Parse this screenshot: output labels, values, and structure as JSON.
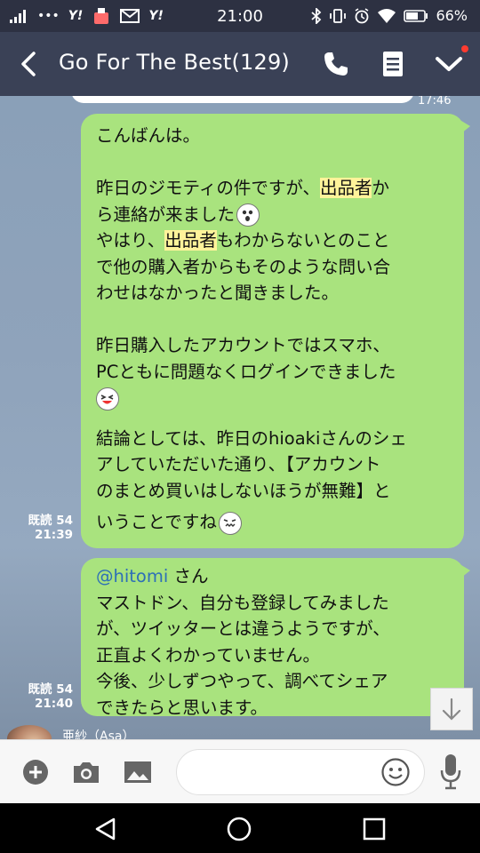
{
  "status_bar": {
    "time": "21:00",
    "battery": "66%",
    "left_glyphs": [
      "•••",
      "Y!",
      "Y!"
    ]
  },
  "header": {
    "title": "Go For The Best(129)",
    "icons": [
      "back-icon",
      "call-icon",
      "notes-icon",
      "chevron-down-icon"
    ],
    "notification_color": "#ff3b30"
  },
  "previous_message": {
    "time": "17:46"
  },
  "messages": [
    {
      "read": "既読 54",
      "time": "21:39",
      "lines": {
        "l1": "こんばんは。",
        "l2a": "昨日のジモティの件ですが、",
        "l2b": "出品者",
        "l2c": "か",
        "l3": "ら連絡が来ました",
        "l4a": "やはり、",
        "l4b": "出品者",
        "l4c": "もわからないとのこと",
        "l5": "で他の購入者からもそのような問い合",
        "l6": "わせはなかったと聞きました。",
        "l7": "昨日購入したアカウントではスマホ、",
        "l8": "PCともに問題なくログインできました",
        "l9": "結論としては、昨日のhioakiさんのシェ",
        "l10": "アしていただいた通り、【アカウント",
        "l11": "のまとめ買いはしないほうが無難】と",
        "l12": "いうことですね"
      }
    },
    {
      "read": "既読 54",
      "time": "21:40",
      "lines": {
        "mention": "@hitomi",
        "san": " さん",
        "l2": "マストドン、自分も登録してみました",
        "l3": "が、ツイッターとは違うようですが、",
        "l4": "正直よくわかっていません。",
        "l5": "今後、少しずつやって、調べてシェア",
        "l6": "できたらと思います。"
      }
    }
  ],
  "next_sender": {
    "name": "亜紗（Asa）"
  },
  "input": {
    "placeholder": "",
    "value": ""
  },
  "colors": {
    "bubble": "#a9e37e",
    "highlight": "#fff39a",
    "mention": "#2d6fb7",
    "header": "#3a4156"
  }
}
